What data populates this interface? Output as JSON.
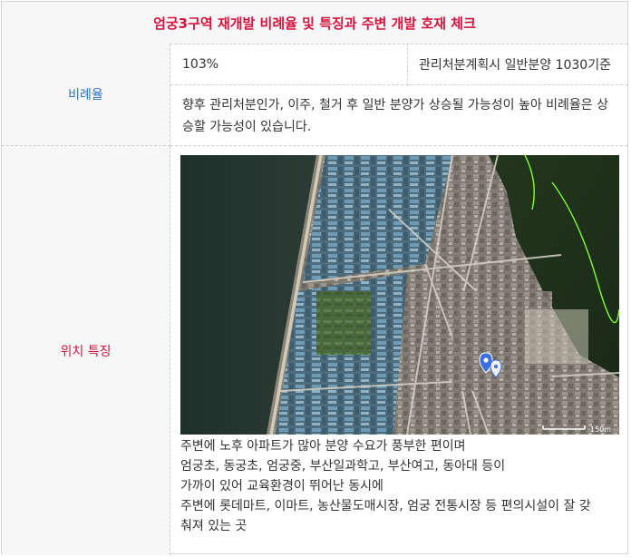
{
  "title": "엄궁3구역 재개발 비례율 및 특징과 주변 개발 호재 체크",
  "ratio_section": {
    "label": "비례율",
    "rate_value": "103%",
    "basis": "관리처분계획시 일반분양 1030기준",
    "description": "향후 관리처분인가, 이주, 철거 후 일반 분양가 상승될 가능성이 높아 비례율은 상승할 가능성이 있습니다."
  },
  "location_section": {
    "label": "위치 특징",
    "map_scale": "150m",
    "notes": [
      "주변에 노후 아파트가 많아 분양 수요가 풍부한 편이며",
      "엄궁초, 동궁초, 엄궁중, 부산일과학고, 부산여고, 동아대 등이",
      "가까이 있어 교육환경이 뛰어난 동시에",
      "주변에 롯데마트, 이마트, 농산물도매시장, 엄궁 전통시장 등 편의시설이 잘 갖",
      "춰져 있는 곳"
    ]
  },
  "colors": {
    "title_text": "#d4143f",
    "ratio_label": "#2d74c4",
    "location_label": "#d4143f",
    "label_background": "#f7f7f7",
    "marker": "#3b6fe0"
  }
}
